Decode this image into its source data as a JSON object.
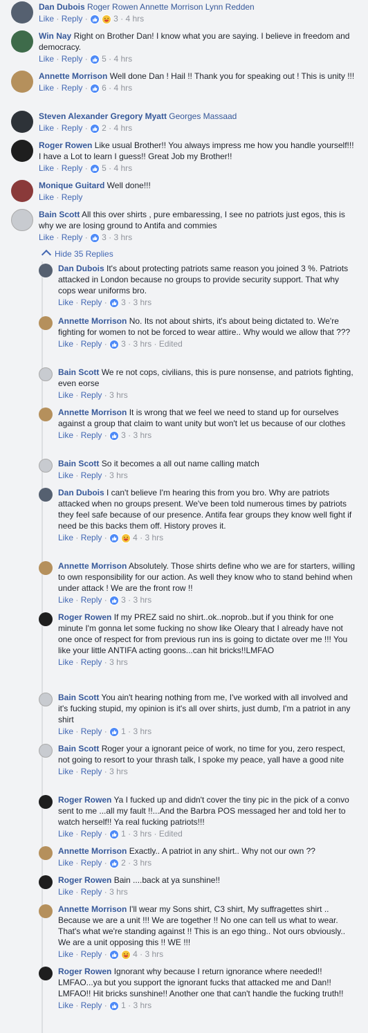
{
  "ui": {
    "like": "Like",
    "reply": "Reply",
    "dot": "·",
    "hide_replies": "Hide 35 Replies"
  },
  "comments": [
    {
      "author": "Dan Dubois",
      "text": "",
      "tagged": "Roger Rowen Annette Morrison Lynn Redden",
      "reacts": [
        "like",
        "haha"
      ],
      "count": "3",
      "time": "4 hrs",
      "edited": ""
    },
    {
      "author": "Win Nay",
      "text": "Right on Brother Dan! I know what you are saying. I believe in freedom and democracy.",
      "tagged": "",
      "reacts": [
        "like"
      ],
      "count": "5",
      "time": "4 hrs",
      "edited": ""
    },
    {
      "author": "Annette Morrison",
      "text": "Well done Dan ! Hail !! Thank you for speaking out ! This is unity !!!",
      "tagged": "",
      "reacts": [
        "like"
      ],
      "count": "6",
      "time": "4 hrs",
      "edited": ""
    },
    {
      "author": "Steven Alexander Gregory Myatt",
      "text": "",
      "tagged": "Georges Massaad",
      "reacts": [
        "like"
      ],
      "count": "2",
      "time": "4 hrs",
      "edited": ""
    },
    {
      "author": "Roger Rowen",
      "text": "Like usual Brother!! You always impress me how you handle yourself!!! I have a Lot to learn I guess!! Great Job my Brother!!",
      "tagged": "",
      "reacts": [
        "like"
      ],
      "count": "5",
      "time": "4 hrs",
      "edited": ""
    },
    {
      "author": "Monique Guitard",
      "text": "Well done!!!",
      "tagged": "",
      "reacts": [],
      "count": "",
      "time": "",
      "edited": ""
    },
    {
      "author": "Bain Scott",
      "text": "All this over shirts , pure embaressing, I see no patriots just egos, this is why we are losing ground to Antifa and commies",
      "tagged": "",
      "reacts": [
        "like"
      ],
      "count": "3",
      "time": "3 hrs",
      "edited": ""
    }
  ],
  "replies": [
    {
      "author": "Dan Dubois",
      "text": "It's about protecting patriots same reason you joined 3 %. Patriots attacked in London because no groups to provide security support. That why cops wear uniforms bro.",
      "reacts": [
        "like"
      ],
      "count": "3",
      "time": "3 hrs",
      "edited": ""
    },
    {
      "author": "Annette Morrison",
      "text": "No. Its not about shirts, it's about being dictated to. We're fighting for women to not be forced to wear attire.. Why would we allow that ???",
      "reacts": [
        "like"
      ],
      "count": "3",
      "time": "3 hrs",
      "edited": "Edited"
    },
    {
      "author": "Bain Scott",
      "text": "We re not cops, civilians, this is pure nonsense, and patriots fighting, even eorse",
      "reacts": [],
      "count": "",
      "time": "3 hrs",
      "edited": ""
    },
    {
      "author": "Annette Morrison",
      "text": "It is wrong that we feel we need to stand up for ourselves against a group that claim to want unity but won't let us because of our clothes",
      "reacts": [
        "like"
      ],
      "count": "3",
      "time": "3 hrs",
      "edited": ""
    },
    {
      "author": "Bain Scott",
      "text": "So it becomes a all out name calling match",
      "reacts": [],
      "count": "",
      "time": "3 hrs",
      "edited": ""
    },
    {
      "author": "Dan Dubois",
      "text": "I can't believe I'm hearing this from you bro. Why are patriots attacked when no groups present. We've been told numerous times by patriots they feel safe because of our presence. Antifa fear groups they know well fight if need be this backs them off. History proves it.",
      "reacts": [
        "like",
        "haha"
      ],
      "count": "4",
      "time": "3 hrs",
      "edited": ""
    },
    {
      "author": "Annette Morrison",
      "text": "Absolutely. Those shirts define who we are for starters, willing to own responsibility for our action. As well they know who to stand behind when under attack ! We are the front row !!",
      "reacts": [
        "like"
      ],
      "count": "3",
      "time": "3 hrs",
      "edited": ""
    },
    {
      "author": "Roger Rowen",
      "text": "If my PREZ said no shirt..ok..noprob..but if you think for one minute I'm gonna let some fucking no show like Oleary that I already have not one once of respect for from previous run ins is going to dictate over me !!! You like your little ANTIFA acting goons...can hit bricks!!LMFAO",
      "reacts": [],
      "count": "",
      "time": "3 hrs",
      "edited": ""
    },
    {
      "author": "Bain Scott",
      "text": "You ain't hearing nothing from me, I've worked with all involved and it's fucking stupid, my opinion is it's all over shirts, just dumb, I'm a patriot in any shirt",
      "reacts": [
        "like"
      ],
      "count": "1",
      "time": "3 hrs",
      "edited": ""
    },
    {
      "author": "Bain Scott",
      "text": "Roger your a ignorant peice of work, no time for you, zero respect, not going to resort to your thrash talk, I spoke my peace, yall have a good nite",
      "reacts": [],
      "count": "",
      "time": "3 hrs",
      "edited": ""
    },
    {
      "author": "Roger Rowen",
      "text": "Ya I fucked up and didn't cover the tiny pic in the pick of a convo sent to me ...all my fault !!...And the Barbra POS messaged her and told her to watch herself!! Ya real fucking patriots!!!",
      "reacts": [
        "like"
      ],
      "count": "1",
      "time": "3 hrs",
      "edited": "Edited"
    },
    {
      "author": "Annette Morrison",
      "text": "Exactly.. A patriot in any shirt.. Why not our own ??",
      "reacts": [
        "like"
      ],
      "count": "2",
      "time": "3 hrs",
      "edited": ""
    },
    {
      "author": "Roger Rowen",
      "text": "Bain ....back at ya sunshine!!",
      "reacts": [],
      "count": "",
      "time": "3 hrs",
      "edited": ""
    },
    {
      "author": "Annette Morrison",
      "text": "I'll wear my Sons shirt, C3 shirt, My suffragettes shirt .. Because we are a unit !!! We are together !! No one can tell us what to wear. That's what we're standing against !! This is an ego thing.. Not ours obviously.. We are a unit opposing this !! WE !!!",
      "reacts": [
        "like",
        "haha"
      ],
      "count": "4",
      "time": "3 hrs",
      "edited": ""
    },
    {
      "author": "Roger Rowen",
      "text": "Ignorant why because I return ignorance where needed!! LMFAO...ya but you support the ignorant fucks that attacked me and Dan!! LMFAO!! Hit bricks sunshine!! Another one that can't handle the fucking truth!!",
      "reacts": [
        "like"
      ],
      "count": "1",
      "time": "3 hrs",
      "edited": ""
    }
  ]
}
